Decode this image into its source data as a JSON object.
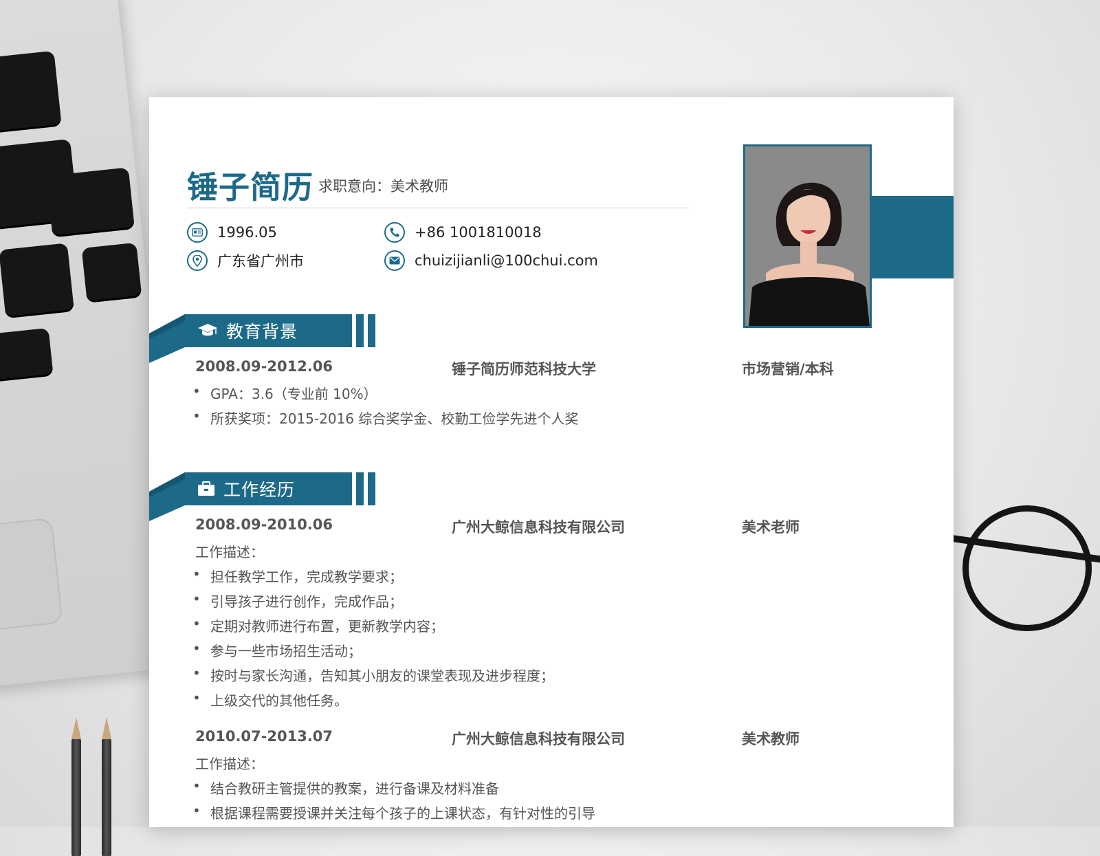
{
  "header": {
    "name": "锤子简历",
    "intent_label": "求职意向：",
    "intent_value": "美术教师"
  },
  "contact": {
    "birth": "1996.05",
    "location": "广东省广州市",
    "phone": "+86 1001810018",
    "email": "chuizijianli@100chui.com"
  },
  "colors": {
    "accent": "#1d6a88",
    "text": "#555555"
  },
  "education": {
    "title": "教育背景",
    "icon": "graduation-cap-icon",
    "entry": {
      "date": "2008.09-2012.06",
      "school": "锤子简历师范科技大学",
      "major": "市场营销/本科",
      "bullets": [
        "GPA：3.6（专业前 10%）",
        "所获奖项：2015-2016 综合奖学金、校勤工俭学先进个人奖"
      ]
    }
  },
  "work": {
    "title": "工作经历",
    "icon": "briefcase-icon",
    "jobs": [
      {
        "date": "2008.09-2010.06",
        "company": "广州大鲸信息科技有限公司",
        "role": "美术老师",
        "desc_label": "工作描述：",
        "bullets": [
          "担任教学工作，完成教学要求；",
          "引导孩子进行创作，完成作品；",
          "定期对教师进行布置，更新教学内容；",
          "参与一些市场招生活动；",
          "按时与家长沟通，告知其小朋友的课堂表现及进步程度；",
          "上级交代的其他任务。"
        ]
      },
      {
        "date": "2010.07-2013.07",
        "company": "广州大鲸信息科技有限公司",
        "role": "美术教师",
        "desc_label": "工作描述：",
        "bullets": [
          "结合教研主管提供的教案，进行备课及材料准备",
          "根据课程需要授课并关注每个孩子的上课状态，有针对性的引导"
        ]
      }
    ]
  }
}
